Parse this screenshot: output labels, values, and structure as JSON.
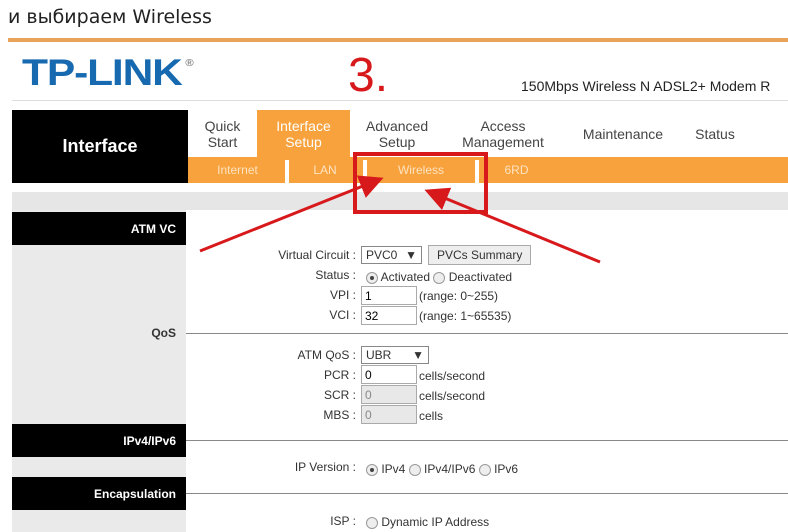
{
  "caption": "и выбираем Wireless",
  "annotation": {
    "step": "3.",
    "color": "#d7191c"
  },
  "header": {
    "logo": "TP-LINK",
    "logo_mark": "®",
    "model": "150Mbps Wireless N ADSL2+ Modem R"
  },
  "section_title": "Interface",
  "nav": [
    {
      "label": "Quick Start",
      "active": false
    },
    {
      "label": "Interface Setup",
      "active": true
    },
    {
      "label": "Advanced Setup",
      "active": false
    },
    {
      "label": "Access Management",
      "active": false
    },
    {
      "label": "Maintenance",
      "active": false
    },
    {
      "label": "Status",
      "active": false
    }
  ],
  "subnav": [
    {
      "label": "Internet"
    },
    {
      "label": "LAN"
    },
    {
      "label": "Wireless",
      "highlighted": true
    },
    {
      "label": "6RD"
    }
  ],
  "sections": {
    "atm_vc": "ATM VC",
    "qos": "QoS",
    "ip": "IPv4/IPv6",
    "encap": "Encapsulation"
  },
  "form": {
    "virtual_circuit": {
      "label": "Virtual Circuit :",
      "value": "PVC0",
      "button": "PVCs Summary"
    },
    "status": {
      "label": "Status :",
      "options": [
        "Activated",
        "Deactivated"
      ],
      "selected": "Activated"
    },
    "vpi": {
      "label": "VPI :",
      "value": "1",
      "hint": "(range: 0~255)"
    },
    "vci": {
      "label": "VCI :",
      "value": "32",
      "hint": "(range: 1~65535)"
    },
    "atm_qos": {
      "label": "ATM QoS :",
      "value": "UBR"
    },
    "pcr": {
      "label": "PCR :",
      "value": "0",
      "unit": "cells/second"
    },
    "scr": {
      "label": "SCR :",
      "value": "0",
      "unit": "cells/second"
    },
    "mbs": {
      "label": "MBS :",
      "value": "0",
      "unit": "cells"
    },
    "ip_version": {
      "label": "IP Version :",
      "options": [
        "IPv4",
        "IPv4/IPv6",
        "IPv6"
      ],
      "selected": "IPv4"
    },
    "isp": {
      "label": "ISP :",
      "option": "Dynamic IP Address"
    }
  },
  "colors": {
    "brand_blue": "#1769b0",
    "nav_orange": "#f7a23c"
  }
}
